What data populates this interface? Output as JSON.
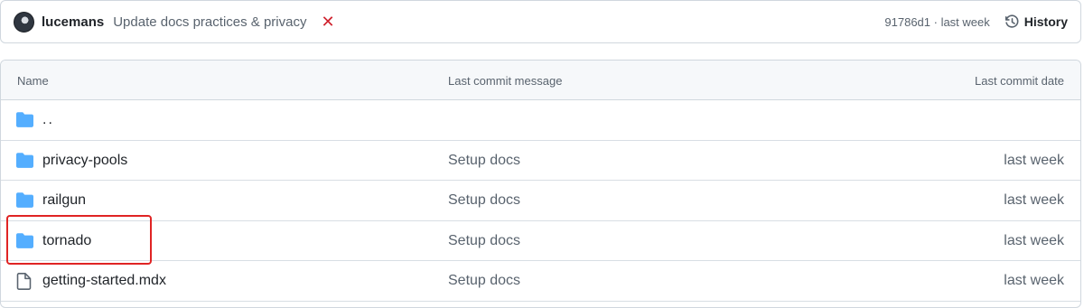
{
  "commit": {
    "author": "lucemans",
    "message": "Update docs practices & privacy",
    "status_symbol": "✕",
    "sha_time": "91786d1 · last week",
    "history_label": "History"
  },
  "table": {
    "headers": {
      "name": "Name",
      "message": "Last commit message",
      "date": "Last commit date"
    },
    "rows": [
      {
        "name": "..",
        "type": "folder",
        "message": "",
        "date": ""
      },
      {
        "name": "privacy-pools",
        "type": "folder",
        "message": "Setup docs",
        "date": "last week"
      },
      {
        "name": "railgun",
        "type": "folder",
        "message": "Setup docs",
        "date": "last week"
      },
      {
        "name": "tornado",
        "type": "folder",
        "message": "Setup docs",
        "date": "last week"
      },
      {
        "name": "getting-started.mdx",
        "type": "file",
        "message": "Setup docs",
        "date": "last week"
      }
    ]
  },
  "colors": {
    "folder": "#54aeff",
    "error": "#cf222e",
    "highlight": "#e02424"
  }
}
